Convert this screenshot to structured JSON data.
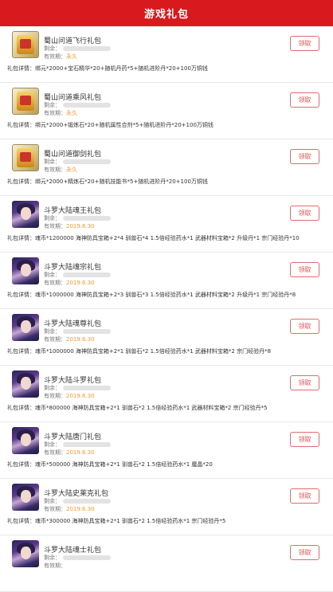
{
  "header": {
    "title": "游戏礼包"
  },
  "labels": {
    "remain": "剩余：",
    "expiry": "有效期：",
    "detail_prefix": "礼包详情：",
    "claim": "领取"
  },
  "items": [
    {
      "icon": "emei-game-icon",
      "title": "蜀山问道飞行礼包",
      "remain": 1.0,
      "expiry": "永久",
      "detail": "礼包详情：绑元*2000+宝石精华*20+随机丹药*5+随机进阶丹*20+100万铜钱"
    },
    {
      "icon": "emei-game-icon",
      "title": "蜀山问道乘风礼包",
      "remain": 1.0,
      "expiry": "永久",
      "detail": "礼包详情：绑元*2000+锻炼石*20+随机属性合剂*5+随机进阶丹*20+100万铜钱"
    },
    {
      "icon": "emei-game-icon",
      "title": "蜀山问道御剑礼包",
      "remain": 1.0,
      "expiry": "永久",
      "detail": "礼包详情：绑元*2000+精炼石*20+随机技能书*5+随机进阶丹*20+100万铜钱"
    },
    {
      "icon": "douluo-game-icon",
      "title": "斗罗大陆魂王礼包",
      "remain": 1.0,
      "expiry": "2019.6.30",
      "detail": "礼包详情：魂币*1200000 海神防具宝箱+2*4 驯兽石*4 1.5倍经验药水*1 武器材料宝箱*2 升级丹*1 宗门经验丹*10"
    },
    {
      "icon": "douluo-game-icon",
      "title": "斗罗大陆魂宗礼包",
      "remain": 1.0,
      "expiry": "2019.6.30",
      "detail": "礼包详情：魂币*1000000 海神防具宝箱+2*3 驯兽石*3 1.5倍经验药水*1 武器材料宝箱*2 升级丹*1 宗门经验丹*8"
    },
    {
      "icon": "douluo-game-icon",
      "title": "斗罗大陆魂尊礼包",
      "remain": 1.0,
      "expiry": "2019.6.30",
      "detail": "礼包详情：魂币*1000000 海神防具宝箱+2*1 驯兽石*2 1.5倍经验药水*1 武器材料宝箱*2 宗门经验丹*8"
    },
    {
      "icon": "douluo-game-icon",
      "title": "斗罗大陆斗罗礼包",
      "remain": 1.0,
      "expiry": "2019.6.30",
      "detail": "礼包详情：魂币*800000 海神防具宝箱+2*1 驯兽石*2 1.5倍经验药水*1 武器材料宝箱*2 宗门经验丹*5"
    },
    {
      "icon": "douluo-game-icon",
      "title": "斗罗大陆唐门礼包",
      "remain": 1.0,
      "expiry": "2019.6.30",
      "detail": "礼包详情：魂币*500000 海神防具宝箱+2*1 驯兽石*2 1.5倍经验药水*1 魔晶*20"
    },
    {
      "icon": "douluo-game-icon",
      "title": "斗罗大陆史莱克礼包",
      "remain": 1.0,
      "expiry": "2019.6.30",
      "detail": "礼包详情：魂币*300000 海神防具宝箱+2*1 驯兽石*2 1.5倍经验药水*1 宗门经验丹*5"
    },
    {
      "icon": "douluo-game-icon",
      "title": "斗罗大陆魂士礼包",
      "remain": 1.0,
      "expiry": "",
      "detail": ""
    }
  ]
}
